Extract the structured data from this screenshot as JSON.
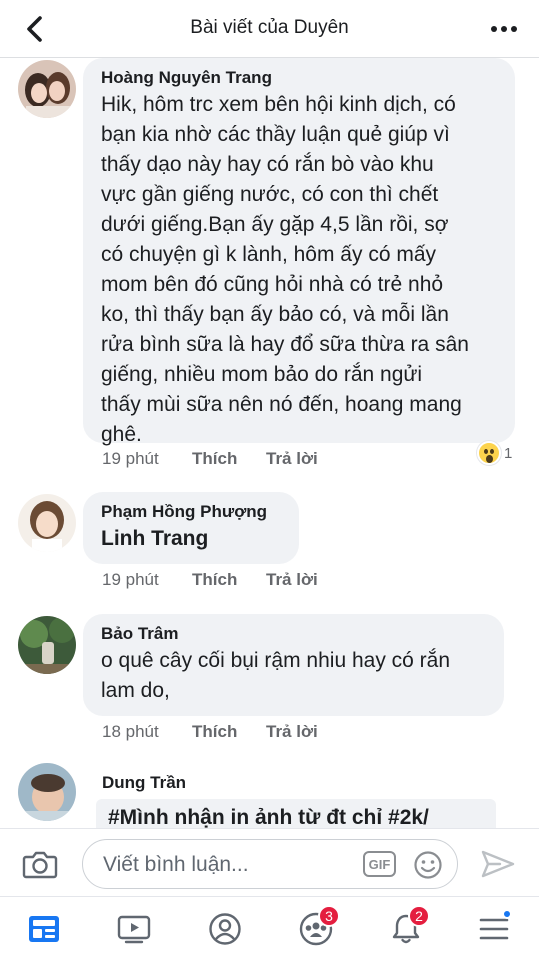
{
  "header": {
    "title": "Bài viết của Duyên",
    "back_icon": "chevron-left-icon",
    "more_icon": "more-dots-icon"
  },
  "comments": [
    {
      "author": "Hoàng Nguyên Trang",
      "text": "Hik, hôm trc xem bên hội kinh dịch, có\nbạn kia nhờ các thầy luận quẻ giúp vì\nthấy dạo này hay có rắn bò vào khu\nvực gần giếng nước, có con thì chết\ndưới giếng.Bạn ấy gặp 4,5 lần rồi, sợ\ncó chuyện gì k lành, hôm ấy có mấy\nmom bên đó cũng hỏi nhà có trẻ nhỏ\nko, thì thấy bạn ấy bảo có, và mỗi lần\nrửa bình sữa là hay đổ sữa thừa ra sân\ngiếng, nhiều mom bảo do rắn ngửi\nthấy mùi sữa nên nó đến, hoang mang\nghê.",
      "time": "19 phút",
      "like": "Thích",
      "reply": "Trả lời",
      "reaction_count": "1"
    },
    {
      "author": "Phạm Hồng Phượng",
      "text": "Linh Trang",
      "time": "19 phút",
      "like": "Thích",
      "reply": "Trả lời"
    },
    {
      "author": "Bảo Trâm",
      "text": "o quê cây cối bụi rậm nhiu hay có rắn\nlam do,",
      "time": "18 phút",
      "like": "Thích",
      "reply": "Trả lời"
    },
    {
      "author": "Dung Trần",
      "text": "#Mình nhận in ảnh từ đt chỉ #2k/"
    }
  ],
  "composer": {
    "placeholder": "Viết bình luận...",
    "gif_label": "GIF"
  },
  "nav": {
    "groups_badge": "3",
    "notifications_badge": "2"
  },
  "colors": {
    "bubble": "#f0f2f5",
    "meta_text": "#65676b",
    "badge": "#e41e3f",
    "accent": "#1877f2"
  }
}
